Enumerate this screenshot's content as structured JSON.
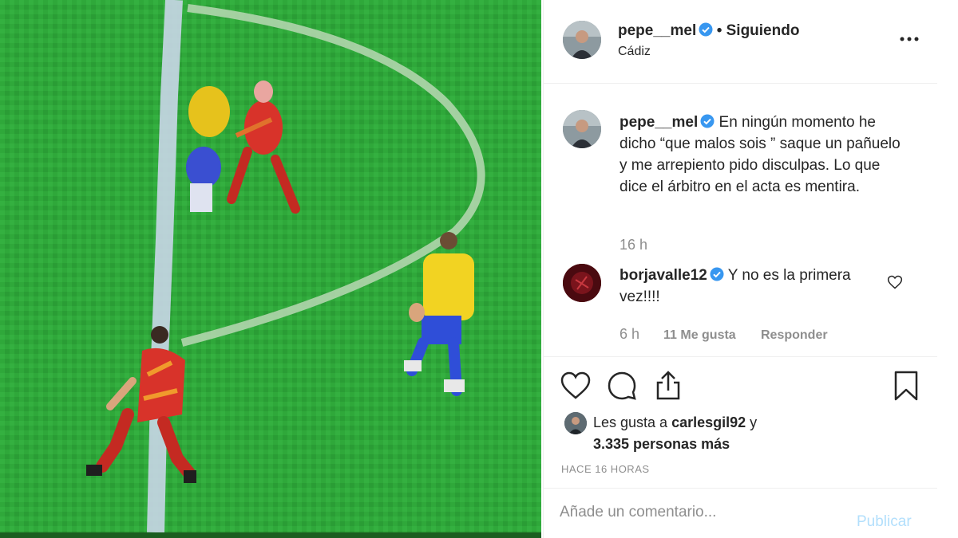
{
  "post": {
    "author": "pepe__mel",
    "follow_status": "• Siguiendo",
    "location": "Cádiz",
    "caption_author": "pepe__mel",
    "caption": "En ningún momento he dicho “que malos sois ” saque un pañuelo y me arrepiento pido disculpas. Lo que dice el árbitro en el acta es mentira.",
    "caption_time": "16 h"
  },
  "comments": [
    {
      "author": "borjavalle12",
      "text": "Y no es la primera vez!!!!",
      "time": "6 h",
      "likes": "11 Me gusta",
      "reply_label": "Responder"
    }
  ],
  "likes": {
    "prefix": "Les gusta a ",
    "user": "carlesgil92",
    "suffix": " y",
    "others": "3.335 personas más"
  },
  "timestamp": "HACE 16 HORAS",
  "add_comment": {
    "placeholder": "Añade un comentario...",
    "publish_label": "Publicar"
  },
  "colors": {
    "verified": "#3897f0",
    "pitch": "#2fa83a",
    "publish_disabled": "#b2dffc"
  },
  "icons": [
    "more-options-icon",
    "verified-icon",
    "heart-icon",
    "comment-icon",
    "share-icon",
    "bookmark-icon"
  ]
}
